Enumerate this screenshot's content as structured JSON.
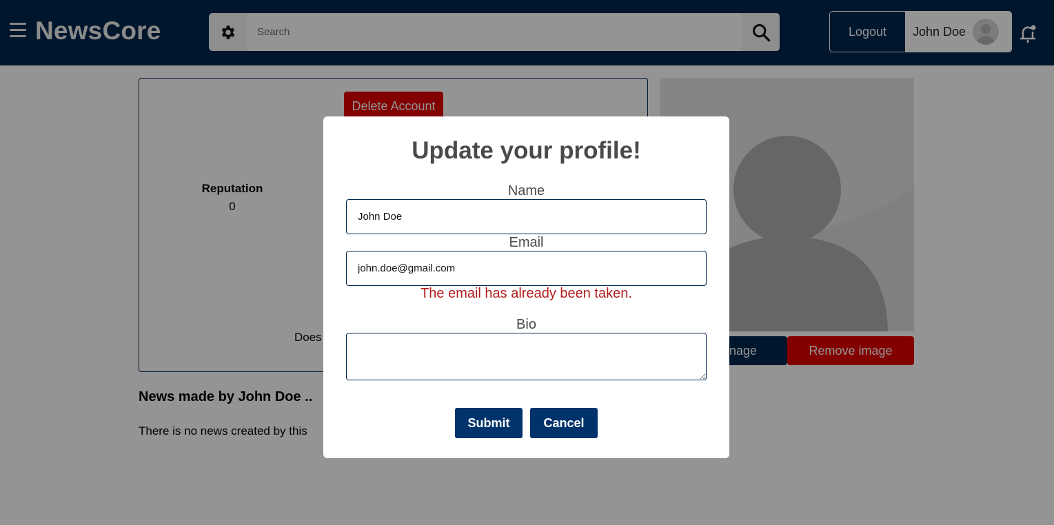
{
  "navbar": {
    "brand": "NewsCore",
    "search": {
      "placeholder": "Search",
      "value": ""
    },
    "logout_label": "Logout",
    "user_name": "John Doe",
    "colors": {
      "bar": "#00264d",
      "accent_red": "#e00000"
    }
  },
  "profile": {
    "delete_account_label": "Delete Account",
    "reputation_label": "Reputation",
    "reputation_value": "0",
    "bio_partial": "Does",
    "change_image_label": "nage",
    "remove_image_label": "Remove image",
    "news_heading": "News made by John Doe ..",
    "news_empty": "There is no news created by this"
  },
  "modal": {
    "title": "Update your profile!",
    "name_label": "Name",
    "name_value": "John Doe",
    "email_label": "Email",
    "email_value": "john.doe@gmail.com",
    "email_error": "The email has already been taken.",
    "bio_label": "Bio",
    "bio_value": "",
    "submit_label": "Submit",
    "cancel_label": "Cancel"
  },
  "icons": [
    "menu-icon",
    "gear-icon",
    "search-icon",
    "avatar-icon",
    "bell-icon",
    "profile-placeholder-icon"
  ]
}
